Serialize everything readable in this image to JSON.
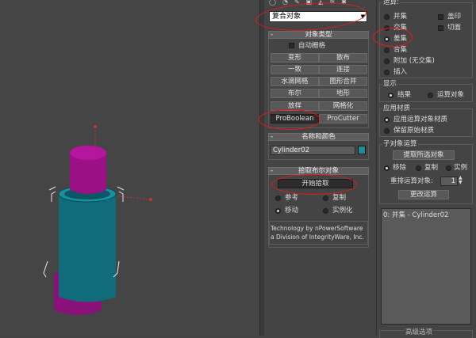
{
  "type_dropdown": {
    "value": "复合对象"
  },
  "object_type": {
    "title": "对象类型",
    "auto_grid": "自动栅格",
    "buttons": [
      "变形",
      "散布",
      "一致",
      "连接",
      "水滴网格",
      "图形合并",
      "布尔",
      "地形",
      "放样",
      "网格化",
      "ProBoolean",
      "ProCutter"
    ]
  },
  "name_color": {
    "title": "名称和颜色",
    "name": "Cylinder02",
    "color": "#1b8c9a"
  },
  "pick_boolean": {
    "title": "拾取布尔对象",
    "start_pick": "开始拾取",
    "options": [
      "参考",
      "复制",
      "移动",
      "实例化"
    ],
    "selected": "移动",
    "info_line1": "Technology by nPowerSoftware",
    "info_line2": "a Division of IntegrityWare, Inc."
  },
  "operation": {
    "title": "运算:",
    "items": [
      "并集",
      "交集",
      "差集",
      "合集",
      "附加 (无交集)",
      "插入"
    ],
    "selected": "差集",
    "checkboxes": [
      "盖印",
      "切面"
    ]
  },
  "display": {
    "title": "显示",
    "options": [
      "结果",
      "运算对象"
    ],
    "selected": "结果"
  },
  "apply_material": {
    "title": "应用材质",
    "options": [
      "应用运算对象材质",
      "保留原始材质"
    ],
    "selected": "应用运算对象材质"
  },
  "sub_object": {
    "title": "子对象运算",
    "extract_btn": "提取所选对象",
    "modes": [
      "移除",
      "复制",
      "实例"
    ],
    "selected": "移除",
    "reorder_label": "重排运算对象:",
    "reorder_value": "1",
    "change_btn": "更改运算"
  },
  "operand_list": [
    "0: 并集 - Cylinder02"
  ],
  "bottom_partial": "高级选项"
}
